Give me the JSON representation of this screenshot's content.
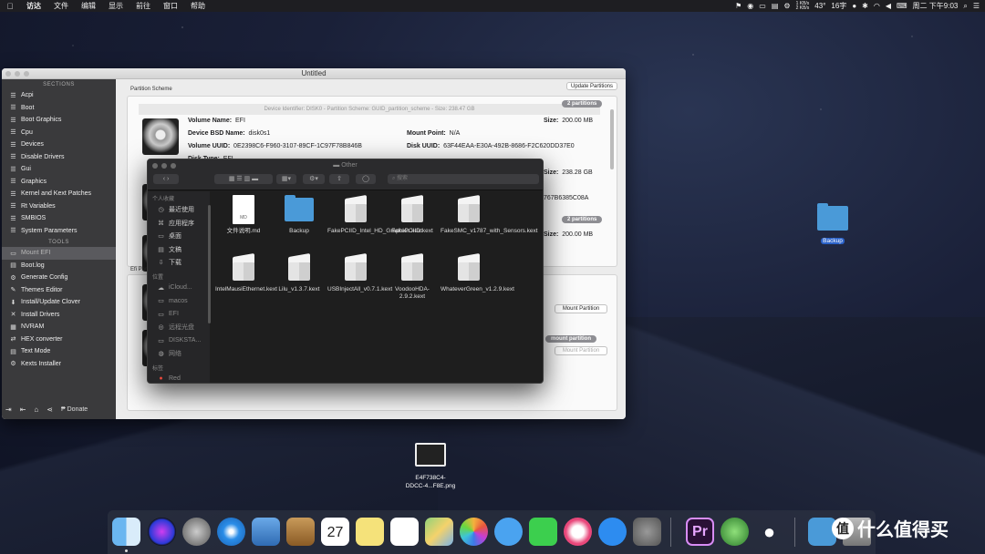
{
  "menubar": {
    "apple": "",
    "items": [
      "访达",
      "文件",
      "编辑",
      "显示",
      "前往",
      "窗口",
      "帮助"
    ],
    "net_up": "1 KB/s",
    "net_down": "2 KB/s",
    "temp": "43°",
    "ime": "16字",
    "clock": "周二 下午9:03"
  },
  "clover": {
    "title": "Untitled",
    "sections_header": "SECTIONS",
    "tools_header": "TOOLS",
    "sections": [
      "Acpi",
      "Boot",
      "Boot Graphics",
      "Cpu",
      "Devices",
      "Disable Drivers",
      "Gui",
      "Graphics",
      "Kernel and Kext Patches",
      "Rt Variables",
      "SMBIOS",
      "System Parameters"
    ],
    "tools": [
      "Mount EFI",
      "Boot.log",
      "Generate Config",
      "Themes Editor",
      "Install/Update Clover",
      "Install Drivers",
      "NVRAM",
      "HEX converter",
      "Text Mode",
      "Kexts Installer"
    ],
    "donate": "Donate",
    "partition_scheme_label": "Partition Scheme",
    "update_partitions": "Update Partitions",
    "device_header": "Device Identifier: DISK0 - Partition Scheme: GUID_partition_scheme - Size: 238.47 GB",
    "badge_2_partitions": "2 partitions",
    "volume_name_label": "Volume Name:",
    "volume_name": "EFI",
    "size_label": "Size:",
    "size_value": "200.00 MB",
    "bsd_label": "Device BSD Name:",
    "bsd_value": "disk0s1",
    "mount_point_label": "Mount Point:",
    "mount_point_value": "N/A",
    "vol_uuid_label": "Volume UUID:",
    "vol_uuid_value": "0E2398C6-F960-3107-89CF-1C97F78B846B",
    "disk_uuid_label": "Disk UUID:",
    "disk_uuid_value": "63F44EAA-E30A-492B-8686-F2C620DD37E0",
    "disk_type_label": "Disk Type:",
    "disk_type_value": "EFI",
    "size2_value": "238.28 GB",
    "uuid2_tail": "767B6385C08A",
    "size3_value": "200.00 MB",
    "efi_partitions_label": "Efi Partitions",
    "mount_partition": "Mount Partition",
    "mount_partition_pill": "mount partition"
  },
  "finder": {
    "title": "Other",
    "search_placeholder": "搜索",
    "favorites_header": "个人收藏",
    "favorites": [
      {
        "label": "最近使用",
        "icon": "clock-icon"
      },
      {
        "label": "应用程序",
        "icon": "apps-icon"
      },
      {
        "label": "桌面",
        "icon": "desktop-icon"
      },
      {
        "label": "文稿",
        "icon": "doc-icon"
      },
      {
        "label": "下载",
        "icon": "download-icon"
      }
    ],
    "locations_header": "位置",
    "locations": [
      {
        "label": "iCloud...",
        "icon": "cloud-icon"
      },
      {
        "label": "macos",
        "icon": "disk-icon"
      },
      {
        "label": "EFI",
        "icon": "disk-icon"
      },
      {
        "label": "远程光盘",
        "icon": "disc-icon"
      },
      {
        "label": "DISKSTA...",
        "icon": "disk-icon"
      },
      {
        "label": "网络",
        "icon": "globe-icon"
      }
    ],
    "tags_header": "标签",
    "tag_red": "Red",
    "files": [
      {
        "name": "文件说明.md",
        "kind": "doc",
        "ext": "MD"
      },
      {
        "name": "Backup",
        "kind": "folder"
      },
      {
        "name": "FakePCIID_Intel_HD_Graphics.kext",
        "kind": "kext"
      },
      {
        "name": "FakePCIID.kext",
        "kind": "kext"
      },
      {
        "name": "FakeSMC_v1787_with_Sensors.kext",
        "kind": "kext"
      },
      {
        "name": "IntelMausiEthernet.kext",
        "kind": "kext"
      },
      {
        "name": "Lilu_v1.3.7.kext",
        "kind": "kext"
      },
      {
        "name": "USBInjectAll_v0.7.1.kext",
        "kind": "kext"
      },
      {
        "name": "VoodooHDA-2.9.2.kext",
        "kind": "kext"
      },
      {
        "name": "WhateverGreen_v1.2.9.kext",
        "kind": "kext"
      }
    ]
  },
  "desktop": {
    "folder_label": "Backup",
    "file_label_1": "E4F738C4-",
    "file_label_2": "DDCC-4...F8E.png"
  },
  "dock": {
    "apps": [
      "Finder",
      "Siri",
      "Launchpad",
      "Safari",
      "Mail",
      "Notes",
      "Calendar",
      "Stickies",
      "Reminders",
      "Maps",
      "Photos",
      "Messages",
      "FaceTime",
      "iTunes",
      "App Store",
      "System Preferences",
      "Premiere",
      "Xbox",
      "QQ",
      "Downloads",
      "Trash"
    ],
    "calendar_day": "27",
    "premiere_label": "Pr"
  },
  "watermark": {
    "badge": "值",
    "text": "什么值得买"
  }
}
